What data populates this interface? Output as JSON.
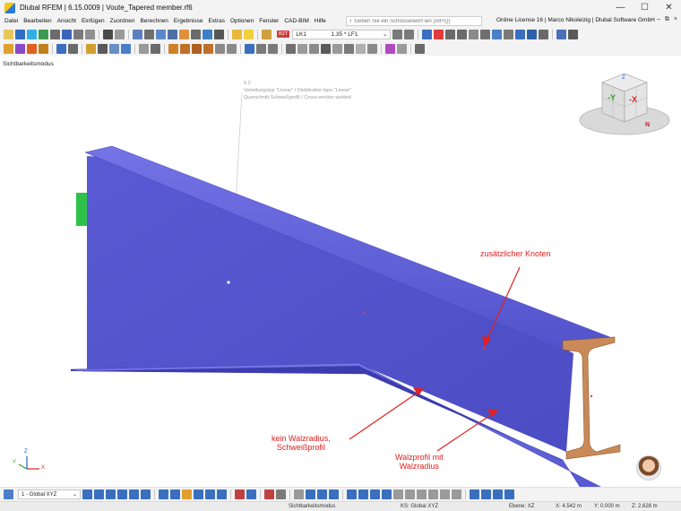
{
  "window": {
    "title": "Dlubal RFEM | 6.15.0009 | Voute_Tapered member.rf6",
    "controls": [
      "minimize-icon",
      "maximize-icon",
      "close-icon"
    ]
  },
  "menu": {
    "items": [
      "Datei",
      "Bearbeiten",
      "Ansicht",
      "Einfügen",
      "Zuordnen",
      "Berechnen",
      "Ergebnisse",
      "Extras",
      "Optionen",
      "Fenster",
      "CAD-BIM",
      "Hilfe"
    ],
    "search_placeholder": "Geben Sie ein Schlüsselwort ein (Alt+Q)",
    "license": "Online License 16 | Marco Nikoleizig | Dlubal Software GmbH"
  },
  "toolbar": {
    "load_case_badge": "BZT",
    "load_case_id": "LK1",
    "load_combination": "1.35 * LF1"
  },
  "viewport": {
    "visibility_mode": "Sichtbarkeitsmodus",
    "annotation": {
      "id": "5.2",
      "line1": "Verteilungstyp \"Linear\" / Distribution type \"Linear\"",
      "line2": "Querschnitt Schweißprofil / Cross-section welded"
    },
    "callouts": {
      "additional_node": "zusätzlicher Knoten",
      "no_root_radius_line1": "kein Walzradius,",
      "no_root_radius_line2": "Schweißprofil",
      "rolled_line1": "Walzprofil mit",
      "rolled_line2": "Walzradius"
    },
    "nav_cube": {
      "x_label": "-X",
      "y_label": "-Y",
      "z_label": "Z",
      "compass": "N"
    },
    "axis_triad": {
      "x": "X",
      "y": "Y",
      "z": "Z"
    },
    "colors": {
      "member": "#5b5bd6",
      "section_face": "#c98a58",
      "support": "#2ec24a",
      "callout": "#e02020"
    }
  },
  "bottom": {
    "coordinate_system": "1 - Global XYZ"
  },
  "status": {
    "mode": "Sichtbarkeitsmodus",
    "ks": "KS: Global XYZ",
    "plane": "Ebene: XZ",
    "x": "X: 4.542 m",
    "y": "Y: 0.000 m",
    "z": "Z: 2.628 m"
  }
}
